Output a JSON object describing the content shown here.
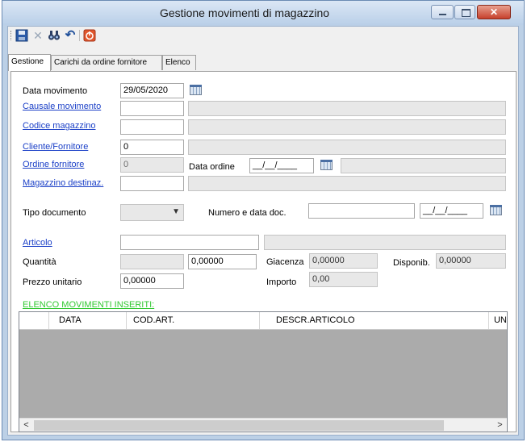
{
  "window": {
    "title": "Gestione movimenti di magazzino",
    "close_glyph": "✕"
  },
  "toolbar": {
    "items": [
      {
        "name": "save-icon",
        "glyph": "💾"
      },
      {
        "name": "delete-icon",
        "glyph": "✕"
      },
      {
        "name": "find-icon",
        "glyph": "🔍"
      },
      {
        "name": "undo-icon",
        "glyph": "↶"
      },
      {
        "name": "exit-icon",
        "glyph": "⏻"
      }
    ]
  },
  "tabs": [
    "Gestione",
    "Carichi da ordine fornitore",
    "Elenco"
  ],
  "form": {
    "data_movimento_label": "Data movimento",
    "data_movimento_value": "29/05/2020",
    "causale_label": "Causale movimento",
    "codice_magazzino_label": "Codice magazzino",
    "cliente_fornitore_label": "Cliente/Fornitore",
    "cliente_fornitore_value": "0",
    "ordine_fornitore_label": "Ordine fornitore",
    "ordine_fornitore_value": "0",
    "data_ordine_label": "Data ordine",
    "data_ordine_value": "__/__/____",
    "magazzino_destinaz_label": "Magazzino destinaz.",
    "tipo_documento_label": "Tipo documento",
    "numero_data_doc_label": "Numero e data doc.",
    "data_doc_value": "__/__/____",
    "articolo_label": "Articolo",
    "quantita_label": "Quantità",
    "quantita_value": "0,00000",
    "giacenza_label": "Giacenza",
    "giacenza_value": "0,00000",
    "disponib_label": "Disponib.",
    "disponib_value": "0,00000",
    "prezzo_unitario_label": "Prezzo unitario",
    "prezzo_unitario_value": "0,00000",
    "importo_label": "Importo",
    "importo_value": "0,00"
  },
  "movements": {
    "heading": "ELENCO MOVIMENTI INSERITI:",
    "columns": [
      "DATA",
      "COD.ART.",
      "DESCR.ARTICOLO",
      "UN"
    ],
    "rows": []
  },
  "colors": {
    "link": "#1a3fc7",
    "heading_green": "#32c832",
    "grid_empty": "#ababab"
  }
}
